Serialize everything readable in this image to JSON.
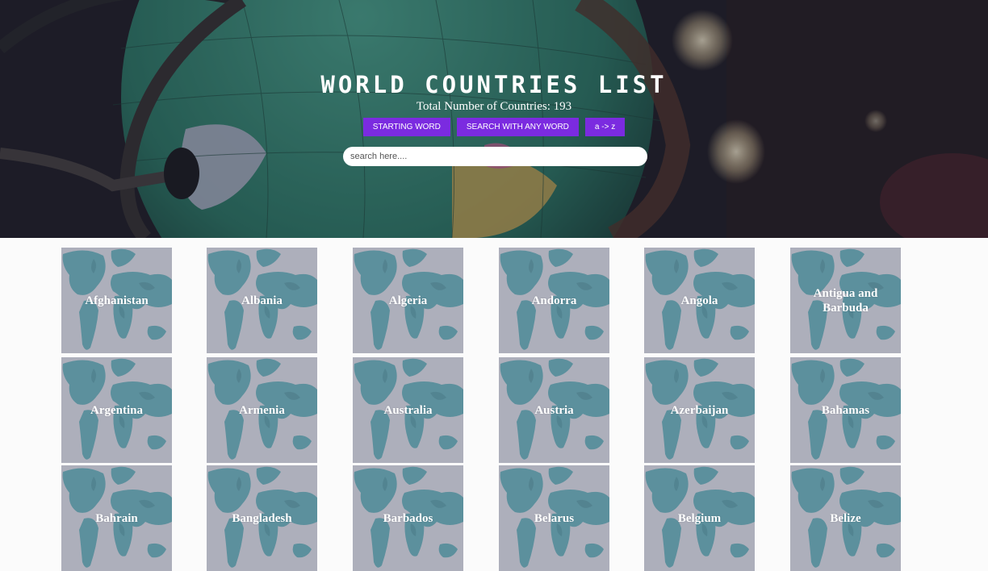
{
  "header": {
    "title": "WORLD COUNTRIES LIST",
    "subtitle": "Total Number of Countries: 193",
    "buttons": [
      {
        "label": "STARTING WORD"
      },
      {
        "label": "SEARCH WITH ANY WORD"
      },
      {
        "label": "a -> z"
      }
    ],
    "search_placeholder": "search here....",
    "accent_color": "#7b2be0"
  },
  "countries": [
    "Afghanistan",
    "Albania",
    "Algeria",
    "Andorra",
    "Angola",
    "Antigua and Barbuda",
    "Argentina",
    "Armenia",
    "Australia",
    "Austria",
    "Azerbaijan",
    "Bahamas",
    "Bahrain",
    "Bangladesh",
    "Barbados",
    "Belarus",
    "Belgium",
    "Belize"
  ],
  "card_icon": "world-map-icon"
}
